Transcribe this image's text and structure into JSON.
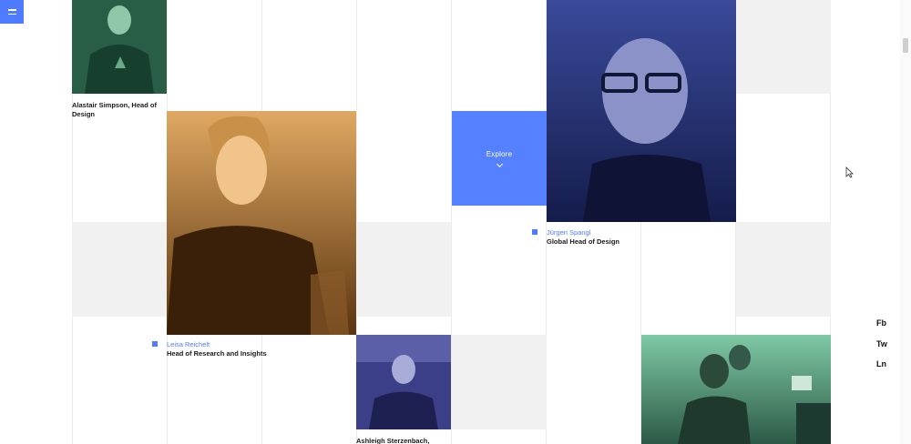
{
  "menu": {
    "icon": "hamburger-icon"
  },
  "people": [
    {
      "name": "Alastair Simpson, Head of Design",
      "role": ""
    },
    {
      "name": "Leisa Reichelt",
      "role": "Head of Research and Insights"
    },
    {
      "name": "Jürgen Spangl",
      "role": "Global Head of Design"
    },
    {
      "name": "Ashleigh Sterzenbach,",
      "role": ""
    }
  ],
  "explore": {
    "label": "Explore",
    "icon": "chevron-down-icon"
  },
  "social": {
    "fb": "Fb",
    "tw": "Tw",
    "ln": "Ln"
  },
  "colors": {
    "accent": "#4f7cff",
    "green_tint": "#2f6b50",
    "orange_tint": "#d89a4f",
    "navy_tint": "#1f2a6b",
    "purple_tint": "#3b3f88",
    "mint_tint": "#4aa37d"
  }
}
